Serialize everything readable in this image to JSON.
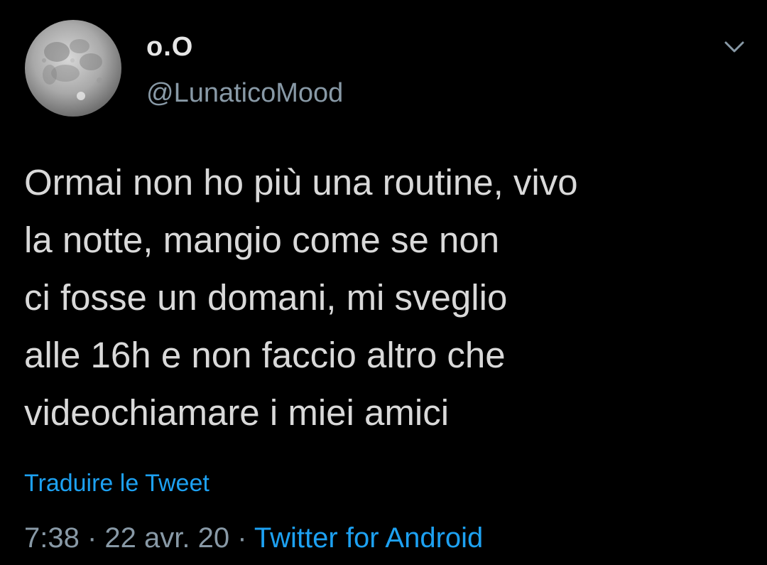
{
  "user": {
    "display_name": "o.O",
    "handle": "@LunaticoMood",
    "avatar_icon": "full-moon-avatar"
  },
  "tweet": {
    "text": "Ormai non ho più una routine, vivo\nla notte, mangio come se non\nci fosse un domani, mi sveglio\nalle 16h e non faccio altro che\nvideochiamare i miei amici",
    "translate_label": "Traduire le Tweet",
    "time": "7:38",
    "separator": " · ",
    "date": "22 avr. 20",
    "source": "Twitter for Android"
  },
  "icons": {
    "more": "chevron-down-icon"
  },
  "colors": {
    "background": "#000000",
    "text": "#d9d9d9",
    "muted": "#8899a6",
    "accent": "#1da1f2"
  }
}
